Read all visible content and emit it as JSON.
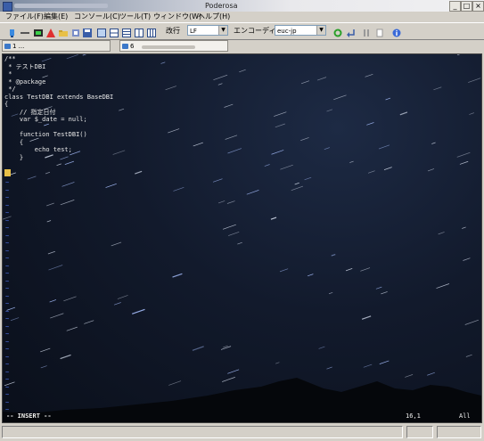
{
  "window": {
    "title": "Poderosa"
  },
  "menu": {
    "items": [
      "ファイル(F)",
      "編集(E)",
      "コンソール(C)",
      "ツール(T)",
      "ウィンドウ(W)",
      "ヘルプ(H)"
    ]
  },
  "toolbar": {
    "newline_label": "改行",
    "newline_value": "LF",
    "encoding_label": "エンコーディング",
    "encoding_value": "euc-jp"
  },
  "tabs": [
    {
      "label": "1 ..."
    },
    {
      "label": "6"
    }
  ],
  "terminal": {
    "code_lines": [
      "/**",
      " * テストDBI",
      " *",
      " * @package",
      " */",
      "class TestDBI extends BaseDBI",
      "{",
      "    // 指定日付",
      "    var $_date = null;",
      "",
      "    function TestDBI()",
      "    {",
      "        echo test;",
      "    }",
      "",
      "}"
    ],
    "cursor_line_char": "?",
    "tilde": "~",
    "mode": "-- INSERT --",
    "position": "16,1",
    "scroll": "All"
  },
  "colors": {
    "accent": "#3a5ea8",
    "tilde": "#4a6de0",
    "cursor": "#e8c048"
  }
}
